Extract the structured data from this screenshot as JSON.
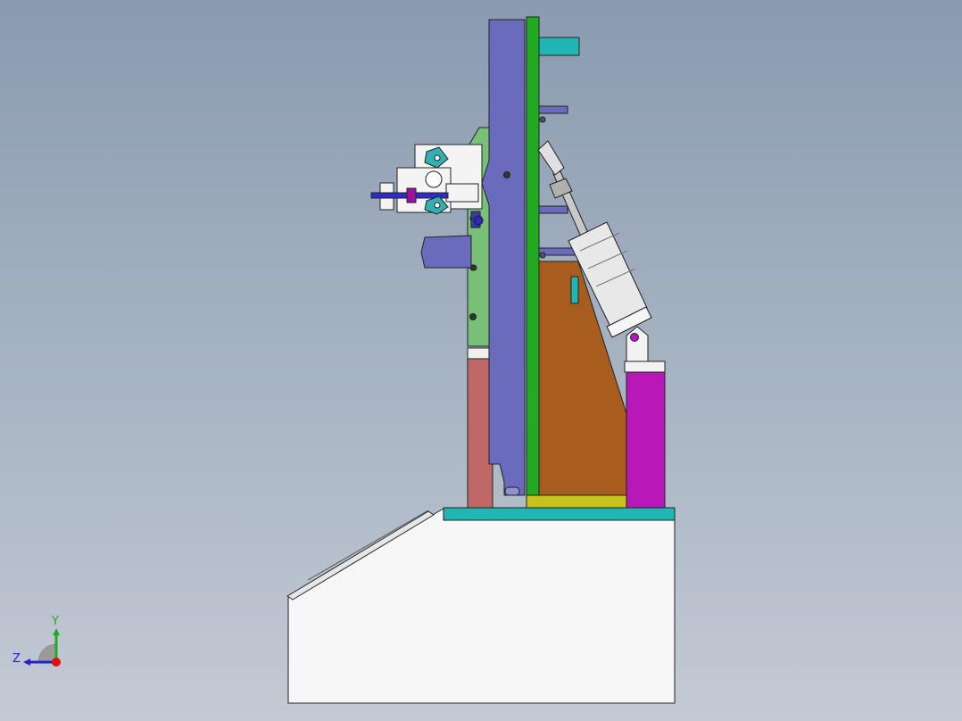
{
  "triad": {
    "y_label": "Y",
    "z_label": "Z",
    "y_color": "#22aa22",
    "z_color": "#2222cc",
    "x_color": "#e01010"
  },
  "colors": {
    "background_top": "#8a9bb0",
    "background_bottom": "#c3cad4",
    "base_cabinet": "#f7f7f7",
    "base_plate": "#20b6b4",
    "column_plate": "#6b6bbd",
    "back_plate": "#22aa22",
    "wedge_block": "#a85c1e",
    "riser_block": "#c06868",
    "support_block": "#b818b8",
    "foot_plate": "#c8c21a",
    "side_frame": "#78c078"
  }
}
